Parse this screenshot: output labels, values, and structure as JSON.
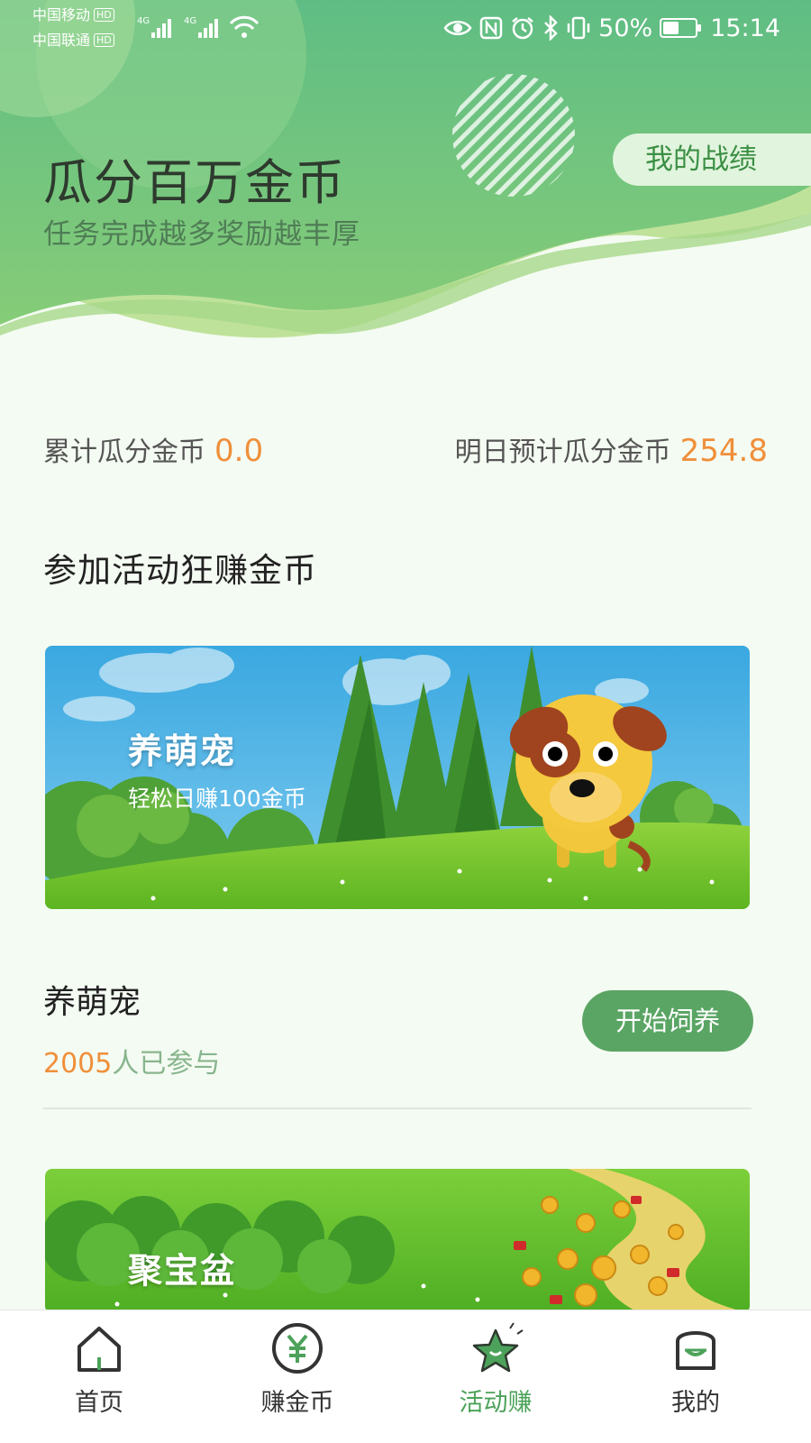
{
  "status_bar": {
    "carrier1": "中国移动",
    "carrier2": "中国联通",
    "hd_badge": "HD",
    "network1": "4G",
    "network2": "4G",
    "battery_percent": "50%",
    "battery_level": 0.5,
    "time": "15:14"
  },
  "header": {
    "title": "瓜分百万金币",
    "subtitle": "任务完成越多奖励越丰厚",
    "record_button": "我的战绩"
  },
  "stats": {
    "total_label": "累计瓜分金币",
    "total_value": "0.0",
    "tomorrow_label": "明日预计瓜分金币",
    "tomorrow_value": "254.8"
  },
  "section_title": "参加活动狂赚金币",
  "activities": [
    {
      "banner_title": "养萌宠",
      "banner_subtitle": "轻松日赚100金币",
      "name": "养萌宠",
      "participants_count": "2005",
      "participants_suffix": "人已参与",
      "button": "开始饲养"
    },
    {
      "banner_title": "聚宝盆"
    }
  ],
  "bottom_nav": [
    {
      "label": "首页",
      "icon": "home-icon"
    },
    {
      "label": "赚金币",
      "icon": "yuan-coin-icon"
    },
    {
      "label": "活动赚",
      "icon": "star-icon",
      "active": true
    },
    {
      "label": "我的",
      "icon": "profile-bag-icon"
    }
  ],
  "colors": {
    "primary_green": "#5aa564",
    "accent_orange": "#ef8f3a",
    "header_green": "#66c084",
    "active_nav": "#4ca25a"
  }
}
